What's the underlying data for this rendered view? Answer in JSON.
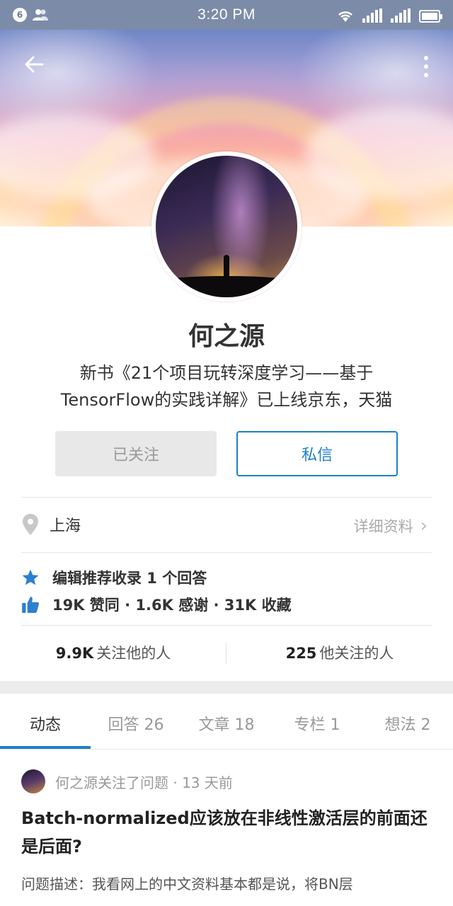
{
  "status_bar": {
    "notification_count": "6",
    "time": "3:20 PM"
  },
  "profile": {
    "name": "何之源",
    "bio_line1": "新书《21个项目玩转深度学习——基于",
    "bio_line2": "TensorFlow的实践详解》已上线京东，天猫",
    "follow_button": "已关注",
    "message_button": "私信",
    "location": "上海",
    "detail_link": "详细资料"
  },
  "achievements": {
    "editor_pick": "编辑推荐收录 1 个回答",
    "stats": "19K 赞同 · 1.6K 感谢 · 31K 收藏"
  },
  "follow_stats": {
    "followers_count": "9.9K",
    "followers_label": "关注他的人",
    "following_count": "225",
    "following_label": "他关注的人"
  },
  "tabs": [
    {
      "label": "动态"
    },
    {
      "label": "回答 26"
    },
    {
      "label": "文章 18"
    },
    {
      "label": "专栏 1"
    },
    {
      "label": "想法 2"
    }
  ],
  "feed": {
    "meta": "何之源关注了问题 · 13 天前",
    "title": "Batch-normalized应该放在非线性激活层的前面还是后面?",
    "body": "问题描述：我看网上的中文资料基本都是说，将BN层"
  },
  "colors": {
    "accent": "#1e80c8",
    "status_bar": "#7c8ca8"
  },
  "icons": [
    "back-arrow-icon",
    "more-vertical-icon",
    "location-pin-icon",
    "star-icon",
    "thumbs-up-icon",
    "chevron-right-icon"
  ]
}
